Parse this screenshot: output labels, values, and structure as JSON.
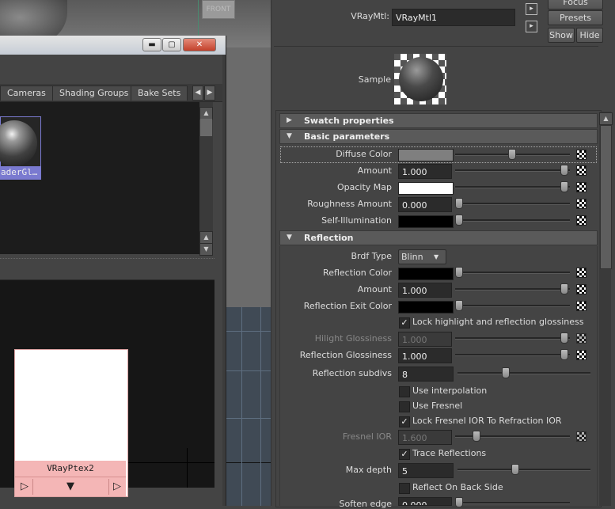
{
  "viewport": {
    "cube_label": "FRONT"
  },
  "hypershade": {
    "window_buttons": {
      "minimize": "▬",
      "maximize": "▢",
      "close": "✕"
    },
    "tabs": [
      "Cameras",
      "Shading Groups",
      "Bake Sets"
    ],
    "scroll_left": "◀",
    "scroll_right": "▶",
    "scroll_up": "▲",
    "scroll_down": "▼",
    "material_label": "aderGl…",
    "node": {
      "name": "VRayPtex2",
      "port_left": "▷",
      "port_mid": "▼",
      "port_right": "▷"
    }
  },
  "ae": {
    "type_label": "VRayMtl:",
    "type_value": "VRayMtl1",
    "buttons": {
      "focus": "Focus",
      "presets": "Presets",
      "show": "Show",
      "hide": "Hide"
    },
    "sample_label": "Sample",
    "sections": {
      "swatch": "Swatch properties",
      "basic": "Basic parameters",
      "reflection": "Reflection"
    },
    "basic": {
      "diffuse_color": "Diffuse Color",
      "amount": "Amount",
      "amount_value": "1.000",
      "opacity_map": "Opacity Map",
      "roughness": "Roughness Amount",
      "roughness_value": "0.000",
      "self_illum": "Self-Illumination"
    },
    "reflection": {
      "brdf_type": "Brdf Type",
      "brdf_value": "Blinn",
      "refl_color": "Reflection Color",
      "amount": "Amount",
      "amount_value": "1.000",
      "exit_color": "Reflection Exit Color",
      "lock_hilight": "Lock highlight and reflection glossiness",
      "hilight_gloss": "Hilight Glossiness",
      "hilight_gloss_value": "1.000",
      "refl_gloss": "Reflection Glossiness",
      "refl_gloss_value": "1.000",
      "subdivs": "Reflection subdivs",
      "subdivs_value": "8",
      "use_interp": "Use interpolation",
      "use_fresnel": "Use Fresnel",
      "lock_fresnel": "Lock Fresnel IOR To Refraction IOR",
      "fresnel_ior": "Fresnel IOR",
      "fresnel_ior_value": "1.600",
      "trace": "Trace Reflections",
      "max_depth": "Max depth",
      "max_depth_value": "5",
      "back_side": "Reflect On Back Side",
      "soften": "Soften edge",
      "soften_value": "0.000"
    },
    "checkmark": "✓"
  }
}
